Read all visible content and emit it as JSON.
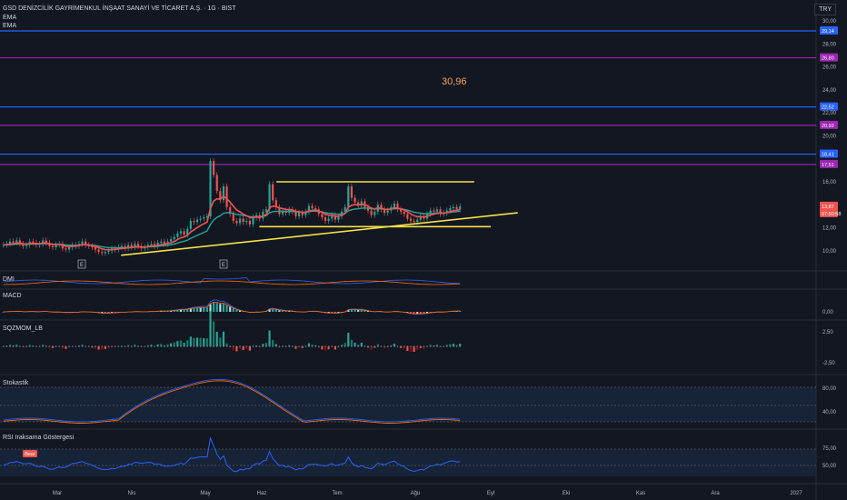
{
  "header": {
    "title": "GSD DENİZCİLİK GAYRİMENKUL İNŞAAT SANAYİ VE TİCARET A.Ş. · 1G · BIST",
    "indicator1": "EMA",
    "indicator2": "EMA",
    "currency": "TRY"
  },
  "annotation": "30,96",
  "colors": {
    "background": "#131722",
    "blue_line": "#2962ff",
    "purple_line": "#9c27b0",
    "yellow_line": "#f5e04a",
    "up_candle": "#26a69a",
    "down_candle": "#ef5350",
    "ema_fast": "#ef5350",
    "ema_slow": "#26a69a"
  },
  "panes": {
    "dmi": "DMI",
    "macd": "MACD",
    "sqz": "SQZMOM_LB",
    "stoch": "Stokastik",
    "rsi": "RSI Iraksama Göstergesi"
  },
  "chart_data": {
    "type": "candlestick",
    "price_axis": {
      "ticks": [
        "30,00",
        "28,00",
        "26,00",
        "24,00",
        "22,00",
        "20,00",
        "16,00",
        "12,00",
        "10,00"
      ],
      "ylim": [
        8.4,
        31.2
      ]
    },
    "price_labels": [
      {
        "value": "29,14",
        "color": "#2962ff"
      },
      {
        "value": "26,80",
        "color": "#9c27b0"
      },
      {
        "value": "22,52",
        "color": "#2962ff"
      },
      {
        "value": "20,92",
        "color": "#9c27b0"
      },
      {
        "value": "18,41",
        "color": "#2962ff"
      },
      {
        "value": "17,51",
        "color": "#9c27b0"
      },
      {
        "value": "13,87",
        "color": "#ef5350"
      },
      {
        "value": "07:50:58",
        "color": "#ef5350"
      }
    ],
    "horizontal_levels": [
      {
        "value": 29.14,
        "color": "#2962ff"
      },
      {
        "value": 26.8,
        "color": "#9c27b0"
      },
      {
        "value": 22.52,
        "color": "#2962ff"
      },
      {
        "value": 20.92,
        "color": "#9c27b0"
      },
      {
        "value": 18.41,
        "color": "#2962ff"
      },
      {
        "value": 17.51,
        "color": "#9c27b0"
      }
    ],
    "trendlines": [
      {
        "from": [
          "Haz-07",
          16.0
        ],
        "to": [
          "Ağu-25",
          16.0
        ]
      },
      {
        "from": [
          "Mar-27",
          9.6
        ],
        "to": [
          "Eyl-12",
          13.3
        ]
      },
      {
        "from": [
          "May-23",
          12.1
        ],
        "to": [
          "Eyl-01",
          12.1
        ]
      }
    ],
    "x_axis": [
      "Mar",
      "Nis",
      "May",
      "Haz",
      "Tem",
      "Ağu",
      "Eyl",
      "Eki",
      "Kas",
      "Ara",
      "2027"
    ],
    "earnings_markers": [
      "E",
      "E"
    ],
    "close_series": [
      10.5,
      10.6,
      10.8,
      10.7,
      10.9,
      10.6,
      10.4,
      10.5,
      10.8,
      10.7,
      10.5,
      10.6,
      10.9,
      10.7,
      10.4,
      10.3,
      10.5,
      10.6,
      10.2,
      10.1,
      10.3,
      10.5,
      10.4,
      10.6,
      10.8,
      10.5,
      10.4,
      10.3,
      10.1,
      9.9,
      9.8,
      9.9,
      10.0,
      10.2,
      10.1,
      10.3,
      10.4,
      10.2,
      10.5,
      10.3,
      10.6,
      10.4,
      10.2,
      10.3,
      10.5,
      10.6,
      10.4,
      10.7,
      10.8,
      10.6,
      10.8,
      11.0,
      11.2,
      11.5,
      11.7,
      11.4,
      11.9,
      12.6,
      12.5,
      12.7,
      12.8,
      12.9,
      13.0,
      17.8,
      16.6,
      15.2,
      14.4,
      15.6,
      13.8,
      13.2,
      12.6,
      12.4,
      12.8,
      12.5,
      12.6,
      12.3,
      12.9,
      13.1,
      12.8,
      13.4,
      13.6,
      15.8,
      14.4,
      13.8,
      13.2,
      13.5,
      13.3,
      13.6,
      13.4,
      13.0,
      13.3,
      13.1,
      13.4,
      13.9,
      13.7,
      13.6,
      13.2,
      12.9,
      12.6,
      12.8,
      13.1,
      12.7,
      13.0,
      13.4,
      13.8,
      15.6,
      14.6,
      14.2,
      13.9,
      14.3,
      13.8,
      13.5,
      13.1,
      13.4,
      14.0,
      13.6,
      13.3,
      13.5,
      13.8,
      14.1,
      13.6,
      13.4,
      13.2,
      12.8,
      12.6,
      12.5,
      12.7,
      13.0,
      12.8,
      13.2,
      13.5,
      13.4,
      13.6,
      13.2,
      13.3,
      13.5,
      13.7,
      13.8,
      13.6,
      13.87
    ]
  }
}
